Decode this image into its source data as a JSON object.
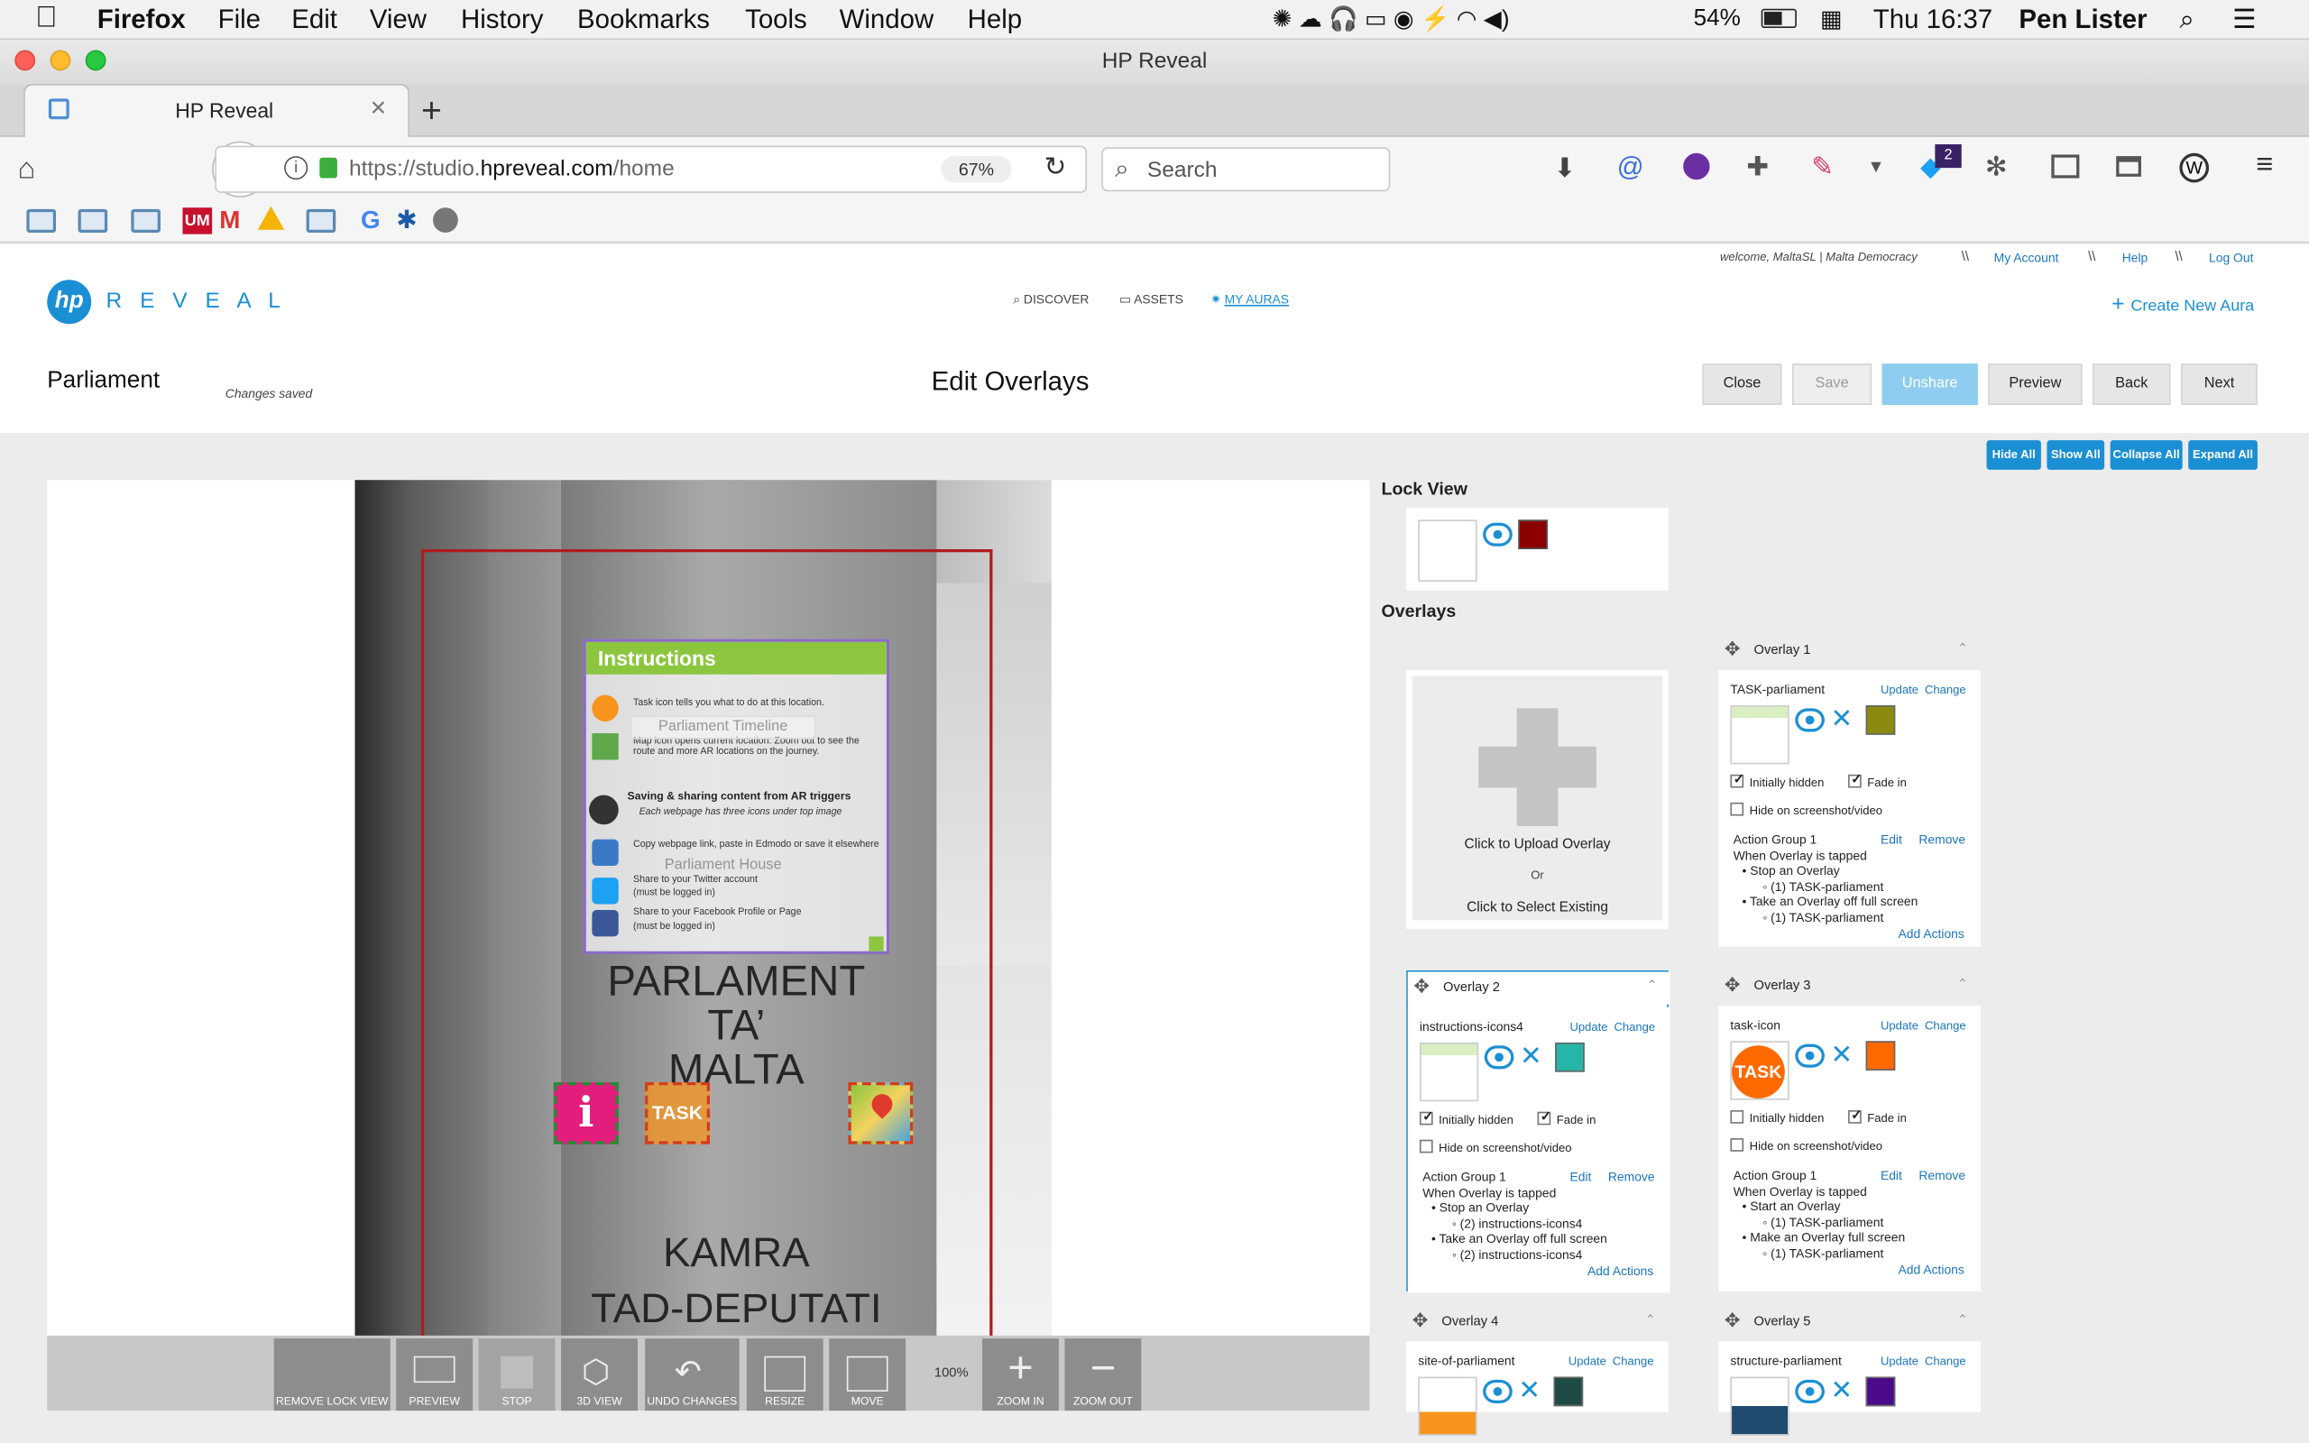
{
  "menubar": {
    "app": "Firefox",
    "items": [
      "File",
      "Edit",
      "View",
      "History",
      "Bookmarks",
      "Tools",
      "Window",
      "Help"
    ],
    "battery": "54%",
    "clock": "Thu 16:37",
    "user": "Pen Lister"
  },
  "window": {
    "title": "HP Reveal"
  },
  "tab": {
    "label": "HP Reveal"
  },
  "nav": {
    "url_prefix": "https://studio.",
    "url_domain": "hpreveal.com",
    "url_path": "/home",
    "zoom": "67%",
    "search_placeholder": "Search",
    "badge": "2"
  },
  "site": {
    "welcome": "welcome, MaltaSL | Malta Democracy",
    "sep": "\\\\",
    "my_account": "My Account",
    "help": "Help",
    "logout": "Log Out",
    "logo_hp": "hp",
    "logo_text": "R E V E A L",
    "nav": [
      "DISCOVER",
      "ASSETS",
      "MY AURAS"
    ],
    "create": "Create New Aura",
    "aura_name": "Parliament",
    "status": "Changes saved",
    "page_title": "Edit Overlays",
    "buttons": [
      "Close",
      "Save",
      "Unshare",
      "Preview",
      "Back",
      "Next"
    ],
    "bulk": [
      "Hide All",
      "Show All",
      "Collapse All",
      "Expand All"
    ]
  },
  "canvas": {
    "instructions_title": "Instructions",
    "lines": [
      "Task icon tells you what to do at this location.",
      "Map icon opens current location. Zoom out to see the route and more AR locations on the journey.",
      "Saving & sharing content from AR triggers",
      "Each webpage has three icons under top image",
      "Copy webpage link, paste in Edmodo or save it elsewhere",
      "Share to your Twitter account",
      "(must be logged in)",
      "Share to your Facebook Profile or Page",
      "(must be logged in)"
    ],
    "overlay_labels": [
      "Parliament Timeline",
      "Parliament House"
    ],
    "sign": [
      "PARLAMENT",
      "TA’",
      "MALTA",
      "KAMRA",
      "TAD-DEPUTATI"
    ],
    "task": "TASK",
    "zoom": "100%"
  },
  "tools": [
    "REMOVE LOCK VIEW",
    "PREVIEW",
    "STOP",
    "3D VIEW",
    "UNDO CHANGES",
    "RESIZE",
    "MOVE",
    "ZOOM IN",
    "ZOOM OUT"
  ],
  "panel": {
    "lock_view": "Lock View",
    "overlays": "Overlays",
    "upload": "Click to Upload Overlay",
    "or": "Or",
    "select": "Click to Select Existing",
    "update": "Update",
    "change": "Change",
    "edit": "Edit",
    "remove": "Remove",
    "add_actions": "Add Actions",
    "initially_hidden": "Initially hidden",
    "fade_in": "Fade in",
    "hide_shot": "Hide on screenshot/video",
    "overlay_list": [
      {
        "title": "Overlay 1",
        "file": "TASK-parliament",
        "color": "#8b8b12",
        "group": "Action Group 1",
        "when": "When Overlay is tapped",
        "a1": "Stop an Overlay",
        "a1s": "(1) TASK-parliament",
        "a2": "Take an Overlay off full screen",
        "a2s": "(1) TASK-parliament"
      },
      {
        "title": "Overlay 2",
        "file": "instructions-icons4",
        "color": "#27b5a8",
        "group": "Action Group 1",
        "when": "When Overlay is tapped",
        "a1": "Stop an Overlay",
        "a1s": "(2) instructions-icons4",
        "a2": "Take an Overlay off full screen",
        "a2s": "(2) instructions-icons4"
      },
      {
        "title": "Overlay 3",
        "file": "task-icon",
        "color": "#ff6a00",
        "group": "Action Group 1",
        "when": "When Overlay is tapped",
        "a1": "Start an Overlay",
        "a1s": "(1) TASK-parliament",
        "a2": "Make an Overlay full screen",
        "a2s": "(1) TASK-parliament"
      },
      {
        "title": "Overlay 4",
        "file": "site-of-parliament",
        "color": "#1f4b47"
      },
      {
        "title": "Overlay 5",
        "file": "structure-parliament",
        "color": "#4b0a8a"
      }
    ]
  },
  "colors": {
    "lock": "#8b0000",
    "accent": "#1b8fd3",
    "unshare": "#8ecdef"
  }
}
